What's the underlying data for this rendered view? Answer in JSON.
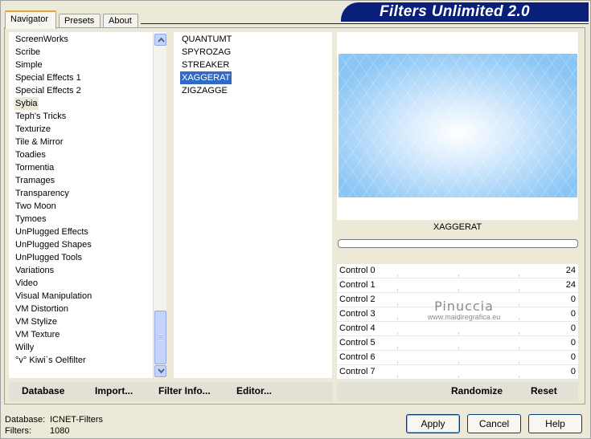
{
  "tabs": [
    {
      "label": "Navigator",
      "active": true
    },
    {
      "label": "Presets",
      "active": false
    },
    {
      "label": "About",
      "active": false
    }
  ],
  "app_title": "Filters Unlimited 2.0",
  "categories": [
    "ScreenWorks",
    "Scribe",
    "Simple",
    "Special Effects 1",
    "Special Effects 2",
    "Sybia",
    "Teph's Tricks",
    "Texturize",
    "Tile & Mirror",
    "Toadies",
    "Tormentia",
    "Tramages",
    "Transparency",
    "Two Moon",
    "Tymoes",
    "UnPlugged Effects",
    "UnPlugged Shapes",
    "UnPlugged Tools",
    "Variations",
    "Video",
    "Visual Manipulation",
    "VM Distortion",
    "VM Stylize",
    "VM Texture",
    "Willy",
    "°v° Kiwi`s Oelfilter"
  ],
  "selected_category": "Sybia",
  "filters": [
    "QUANTUMT",
    "SPYROZAG",
    "STREAKER",
    "XAGGERAT",
    "ZIGZAGGE"
  ],
  "selected_filter": "XAGGERAT",
  "preview": {
    "filter_name": "XAGGERAT",
    "progress": 0
  },
  "controls": [
    {
      "label": "Control 0",
      "value": "24"
    },
    {
      "label": "Control 1",
      "value": "24"
    },
    {
      "label": "Control 2",
      "value": "0"
    },
    {
      "label": "Control 3",
      "value": "0"
    },
    {
      "label": "Control 4",
      "value": "0"
    },
    {
      "label": "Control 5",
      "value": "0"
    },
    {
      "label": "Control 6",
      "value": "0"
    },
    {
      "label": "Control 7",
      "value": "0"
    }
  ],
  "watermark": {
    "line1": "Pinuccia",
    "line2": "www.maidiregrafica.eu"
  },
  "toolbar": {
    "database": "Database",
    "import": "Import...",
    "filter_info": "Filter Info...",
    "editor": "Editor...",
    "randomize": "Randomize",
    "reset": "Reset"
  },
  "status": {
    "database_label": "Database:",
    "database_value": "ICNET-Filters",
    "filters_label": "Filters:",
    "filters_value": "1080"
  },
  "buttons": {
    "apply": "Apply",
    "cancel": "Cancel",
    "help": "Help"
  },
  "colors": {
    "selection": "#316ac5",
    "banner": "#0a1f7a",
    "tab_accent": "#e8a33b"
  }
}
